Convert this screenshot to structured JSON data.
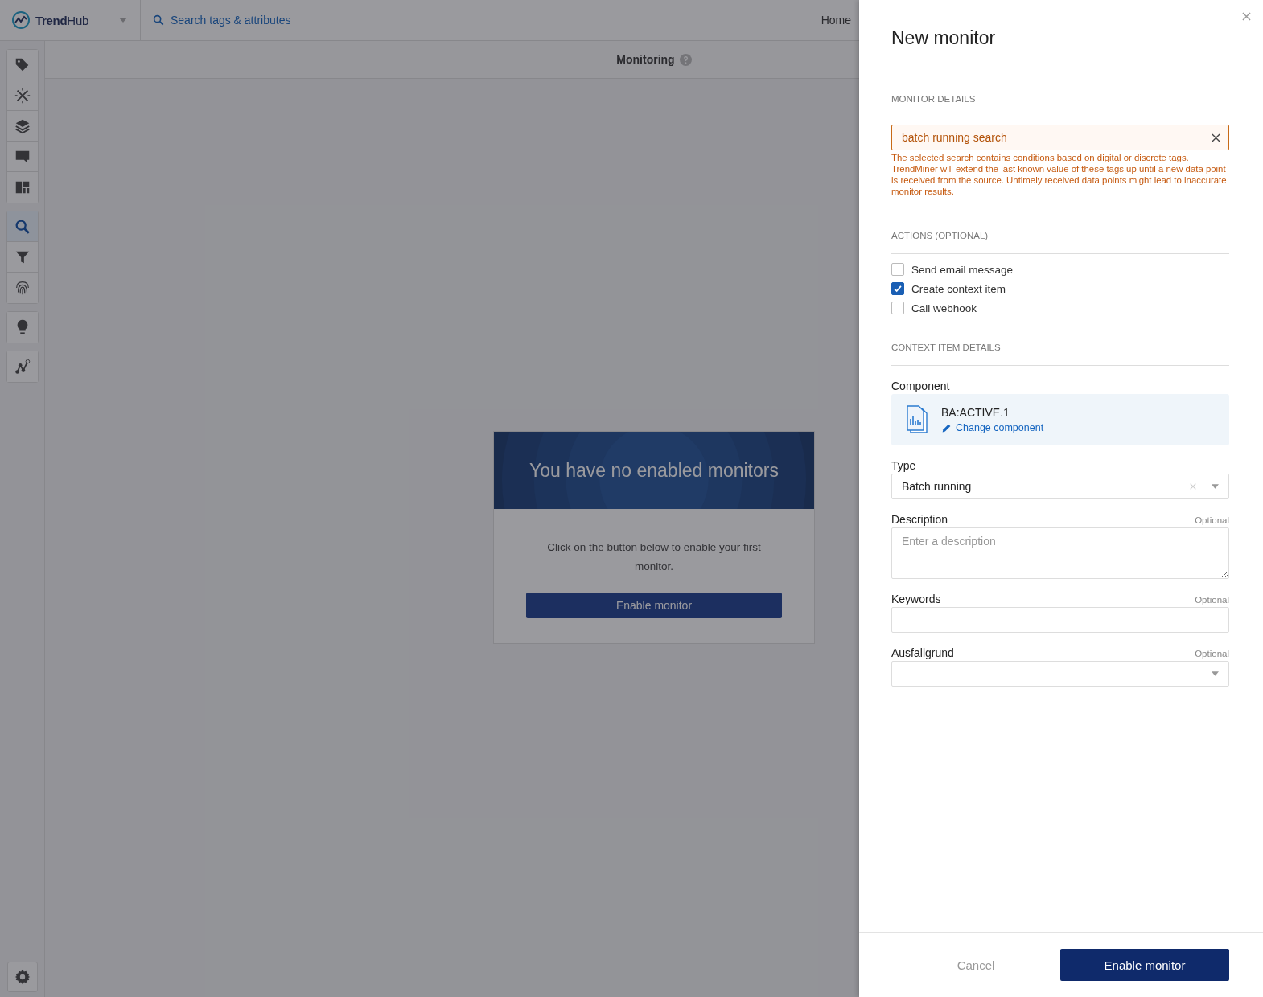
{
  "app": {
    "brand": "**Trend**Hub",
    "search_label": "Search tags & attributes",
    "nav_link": "Home",
    "page_title": "Monitoring",
    "toolbar": {
      "groups": [
        [
          {
            "selected": false
          },
          {
            "selected": false
          },
          {
            "selected": false
          },
          {
            "selected": false
          },
          {
            "selected": false
          }
        ],
        [
          {
            "selected": true
          },
          {
            "selected": false
          },
          {
            "selected": false
          }
        ],
        [
          {
            "selected": false
          }
        ],
        [
          {
            "selected": false
          }
        ]
      ]
    },
    "empty_state": {
      "title": "You have no enabled monitors",
      "message": "Click on the button below to enable your first monitor.",
      "button": "Enable monitor"
    }
  },
  "drawer": {
    "title": "New monitor",
    "monitor_details": {
      "heading": "MONITOR DETAILS",
      "search_value": "batch running search",
      "warning": "The selected search contains conditions based on digital or discrete tags. TrendMiner will extend the last known value of these tags up until a new data point is received from the source. Untimely received data points might lead to inaccurate monitor results."
    },
    "actions": {
      "heading": "ACTIONS (OPTIONAL)",
      "options": [
        {
          "label": "Send email message",
          "checked": false
        },
        {
          "label": "Create context item",
          "checked": true
        },
        {
          "label": "Call webhook",
          "checked": false
        }
      ]
    },
    "context_item": {
      "heading": "CONTEXT ITEM DETAILS",
      "fields": [
        {
          "kind": "component",
          "label": "Component",
          "name": "BA:ACTIVE.1",
          "link": "Change component"
        },
        {
          "kind": "select",
          "label": "Type",
          "value": "Batch running",
          "clearable": true
        },
        {
          "kind": "textarea",
          "label": "Description",
          "optional": "Optional",
          "placeholder": "Enter a description"
        },
        {
          "kind": "text",
          "label": "Keywords",
          "optional": "Optional"
        },
        {
          "kind": "select",
          "label": "Ausfallgrund",
          "optional": "Optional",
          "clearable": false
        }
      ]
    },
    "buttons": {
      "cancel": "Cancel",
      "submit": "Enable monitor"
    }
  }
}
